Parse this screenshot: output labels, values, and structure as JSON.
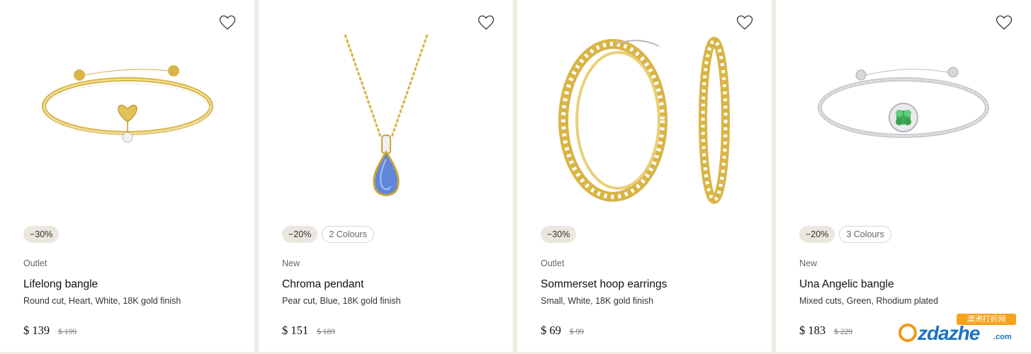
{
  "products": [
    {
      "discount": "−30%",
      "colours": null,
      "badge": "Outlet",
      "name": "Lifelong bangle",
      "description": "Round cut, Heart, White, 18K gold finish",
      "price": "$ 139",
      "old_price": "$ 199",
      "image": "gold-bangle-heart"
    },
    {
      "discount": "−20%",
      "colours": "2 Colours",
      "badge": "New",
      "name": "Chroma pendant",
      "description": "Pear cut, Blue, 18K gold finish",
      "price": "$ 151",
      "old_price": "$ 189",
      "image": "gold-chain-blue-pendant"
    },
    {
      "discount": "−30%",
      "colours": null,
      "badge": "Outlet",
      "name": "Sommerset hoop earrings",
      "description": "Small, White, 18K gold finish",
      "price": "$ 69",
      "old_price": "$ 99",
      "image": "gold-hoop-earrings"
    },
    {
      "discount": "−20%",
      "colours": "3 Colours",
      "badge": "New",
      "name": "Una Angelic bangle",
      "description": "Mixed cuts, Green, Rhodium plated",
      "price": "$ 183",
      "old_price": "$ 229",
      "image": "silver-bangle-green-flower"
    }
  ],
  "watermark": {
    "top_text": "澳洲打折网",
    "brand_rest": "zdazhe",
    "suffix": ".com"
  },
  "colors": {
    "page_bg": "#efece4",
    "card_bg": "#ffffff",
    "tag_bg": "#ebe7df",
    "gold": "#d8b546",
    "silver": "#c9ccd0"
  }
}
